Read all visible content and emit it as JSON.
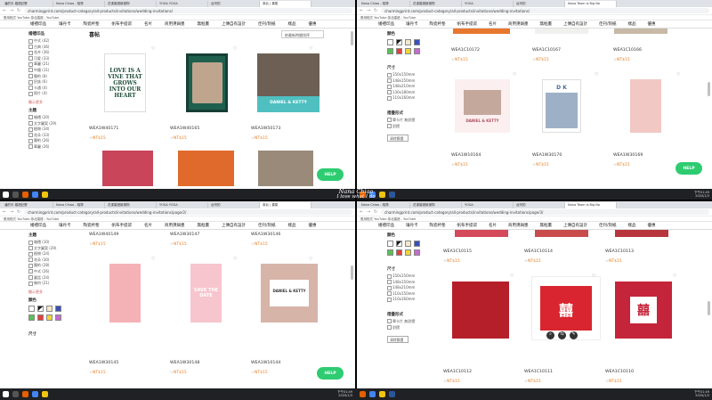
{
  "browser": {
    "tabs_left": [
      "潘的半 婚禮記實",
      "Nana Chiao - 相簿",
      "花漾婚禮新娘物",
      "YOGA YOGA",
      "台灣的",
      "臺北 | 喜氣"
    ],
    "tabs_right": [
      "Nana Chiao - 相簿",
      "花漾婚禮新娘物",
      "YOGA",
      "台灣的",
      "Nana Team is Big No"
    ],
    "urls": [
      "charmingprint.com/product-category/all-products/invitations/wedding-invitations/",
      "charmingprint.com/product-category/all-products/invitations/wedding-invitations/",
      "charmingprint.com/product-category/all-products/invitations/wedding-invitations/page/2/",
      "charmingprint.com/product-category/all-products/invitations/wedding-invitations/page/3/"
    ],
    "bookmarks": "應用程式  YouTube  臺北婚禮 - YouTube"
  },
  "menu": [
    "婚禮印品",
    "壤丹卡",
    "陶瓷杯墊",
    "帆布手提袋",
    "名片",
    "商用燙鍋墨",
    "無框畫",
    "上傳自有設計",
    "佳刊/刻紙",
    "樣品",
    "優惠"
  ],
  "sidebar": {
    "category_title": "婚禮印品",
    "category_items": [
      "中式 (42)",
      "古典 (36)",
      "花卉 (36)",
      "可愛 (33)",
      "華麗 (21)",
      "中國 (11)",
      "簡約 (8)",
      "民族 (6)",
      "卡通 (4)",
      "照片 (4)"
    ],
    "category_items_2": [
      "婚禮 (20)",
      "文字圖案 (29)",
      "植物 (34)",
      "花朵 (33)",
      "簡約 (26)",
      "華麗 (26)",
      "童話 (24)",
      "幾何 (21)"
    ],
    "theme_title": "主題",
    "theme_items": [
      "婚禮 (10)",
      "文字圖案 (29)",
      "植物 (24)",
      "花朵 (30)",
      "簡約 (28)",
      "中式 (26)",
      "童話 (24)",
      "幾何 (21)"
    ],
    "more": "顯示更多",
    "color_title": "顏色",
    "size_title": "尺寸",
    "sizes": [
      "150x150mm",
      "148x150mm",
      "148x210mm",
      "130x180mm",
      "110x160mm"
    ],
    "sizes_2": [
      "150x150mm",
      "148x150mm",
      "148x210mm",
      "110x150mm",
      "110x160mm"
    ],
    "fold_title": "摺疊形式",
    "folds": [
      "單卡片 無對摺",
      "對摺"
    ],
    "reset": "清除篩選"
  },
  "colors": [
    "#ffffff",
    "#1a1a1a",
    "#f3e9c8",
    "#3b4fb8",
    "#5bbf58",
    "#e0413c",
    "#f2d43f",
    "#c36bd1"
  ],
  "page_title": "喜帖",
  "sort_label": "依最新時間排序",
  "help_label": "HELP",
  "price": "NT$15",
  "watermark": {
    "line1": "Nana Chiao",
    "line2": "I love what I do"
  },
  "taskbar": {
    "time": "下午01:49",
    "date": "2020/1/3"
  },
  "top_left": {
    "skus": [
      "WEA1W40171",
      "WEA1W40165",
      "WEA1W50173"
    ],
    "partial_row": [
      "",
      "",
      ""
    ]
  },
  "top_right": {
    "top_skus": [
      "WEA1C10172",
      "WEA1C10167",
      "WEA1C10166"
    ],
    "skus": [
      "WEA1W10164",
      "WEA1W30170",
      "WEA1W30169"
    ]
  },
  "bottom_left": {
    "top_skus": [
      "WEA1W40149",
      "WEA1W30147",
      "WEA1W30146"
    ],
    "skus": [
      "WEA1W30145",
      "WEA1W30148",
      "WEA1W10144"
    ]
  },
  "bottom_right": {
    "top_skus": [
      "WEA1C10115",
      "WEA1C10114",
      "WEA1C10113"
    ],
    "skus": [
      "WEA1C10112",
      "WEA1C10111",
      "WEA1C10110"
    ]
  },
  "card_texts": {
    "love": "LOVE IS A VINE THAT GROWS INTO OUR HEART",
    "daniel_kitty": "DANIEL & KETTY",
    "dk": "D K",
    "save_date": "SAVE THE DATE",
    "xi": "囍"
  }
}
